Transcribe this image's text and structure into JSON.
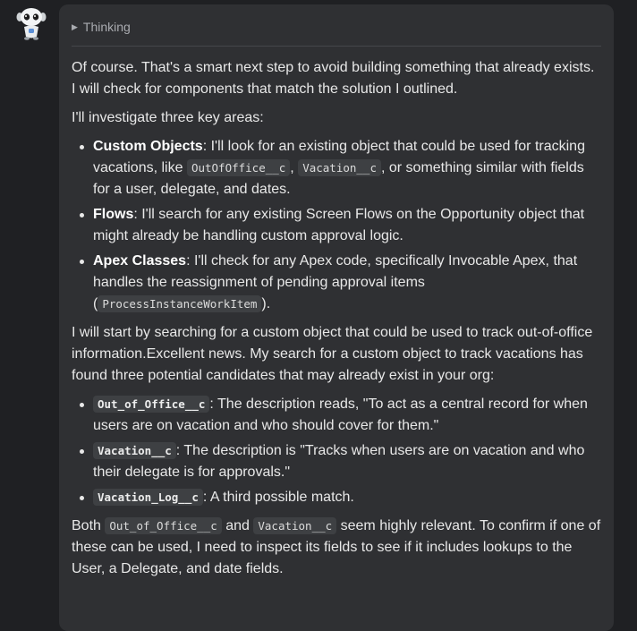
{
  "avatar": {
    "icon": "robot-avatar-icon"
  },
  "thinking": {
    "label": "Thinking",
    "icon": "triangle-right-icon"
  },
  "message": {
    "p1": "Of course. That's a smart next step to avoid building something that already exists. I will check for components that match the solution I outlined.",
    "p2": "I'll investigate three key areas:",
    "areas": [
      {
        "title": "Custom Objects",
        "t1": ": I'll look for an existing object that could be used for tracking vacations, like ",
        "c1": "OutOfOffice__c",
        "t2": ", ",
        "c2": "Vacation__c",
        "t3": ", or something similar with fields for a user, delegate, and dates."
      },
      {
        "title": "Flows",
        "t1": ": I'll search for any existing Screen Flows on the Opportunity object that might already be handling custom approval logic."
      },
      {
        "title": "Apex Classes",
        "t1": ": I'll check for any Apex code, specifically Invocable Apex, that handles the reassignment of pending approval items (",
        "c1": "ProcessInstanceWorkItem",
        "t2": ")."
      }
    ],
    "p3": "I will start by searching for a custom object that could be used to track out-of-office information.Excellent news. My search for a custom object to track vacations has found three potential candidates that may already exist in your org:",
    "candidates": [
      {
        "name": "Out_of_Office__c",
        "text": ": The description reads, \"To act as a central record for when users are on vacation and who should cover for them.\""
      },
      {
        "name": "Vacation__c",
        "text": ": The description is \"Tracks when users are on vacation and who their delegate is for approvals.\""
      },
      {
        "name": "Vacation_Log__c",
        "text": ": A third possible match."
      }
    ],
    "p4": {
      "t1": "Both ",
      "c1": "Out_of_Office__c",
      "t2": " and ",
      "c2": "Vacation__c",
      "t3": " seem highly relevant. To confirm if one of these can be used, I need to inspect its fields to see if it includes lookups to the User, a Delegate, and date fields."
    }
  },
  "colors": {
    "page_bg": "#1f2023",
    "bubble_bg": "#2f3033",
    "code_bg": "#3e4043",
    "muted_text": "#a9abb0"
  }
}
